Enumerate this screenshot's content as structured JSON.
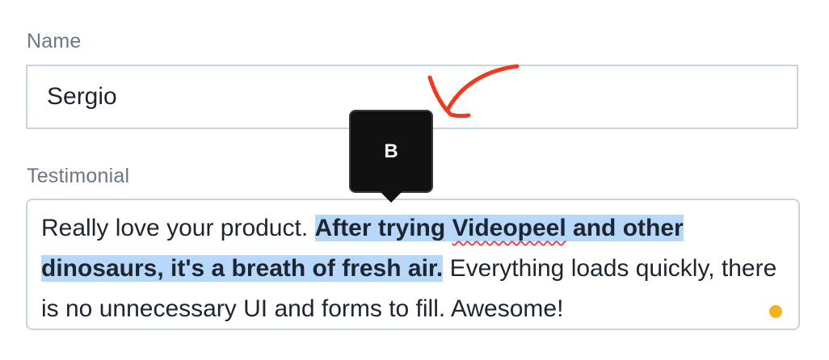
{
  "form": {
    "name_field": {
      "label": "Name",
      "value": "Sergio"
    },
    "testimonial_field": {
      "label": "Testimonial",
      "text_before": "Really love your product. ",
      "selected_part1": "After trying ",
      "misspelled_word": "Videopeel",
      "selected_part2": " and other dinosaurs, it's a breath of fresh air.",
      "text_after": " Everything loads quickly, there is no unnecessary UI and forms to fill. Awesome!"
    }
  },
  "format_tooltip": {
    "bold_label": "B"
  },
  "colors": {
    "selection_highlight": "#b7d7fb",
    "annotation_arrow": "#f03a1f",
    "status_dot": "#f6b21a",
    "tooltip_bg": "#111111"
  },
  "icons": {
    "annotation": "hand-drawn-arrow-icon",
    "status": "status-dot-icon"
  }
}
